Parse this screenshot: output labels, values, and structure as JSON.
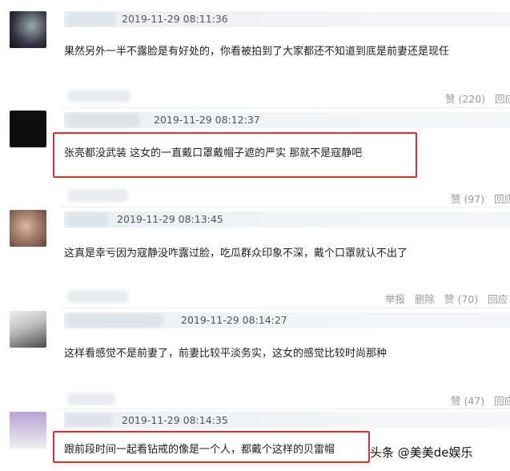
{
  "comments": [
    {
      "timestamp": "2019-11-29 08:11:36",
      "text": "果然另外一半不露脸是有好处的，你看被拍到了大家都还不知道到底是前妻还是现任",
      "actions": [
        "赞 (220)",
        "回应"
      ]
    },
    {
      "timestamp": "2019-11-29 08:12:37",
      "text": "张亮都没武装 这女的一直戴口罩戴帽子遮的严实 那就不是寇静吧",
      "actions": [
        "赞 (97)",
        "回应"
      ],
      "highlight_color": "#e03131"
    },
    {
      "timestamp": "2019-11-29 08:13:45",
      "text": "这真是幸亏因为寇静没咋露过脸，吃瓜群众印象不深，戴个口罩就认不出了",
      "actions": [
        "举报",
        "删除",
        "赞 (70)",
        "回应"
      ]
    },
    {
      "timestamp": "2019-11-29 08:14:27",
      "text": "这样看感觉不是前妻了，前妻比较平淡务实，这女的感觉比较时尚那种",
      "actions": [
        "赞 (47)",
        "回应"
      ]
    },
    {
      "timestamp": "2019-11-29 08:14:35",
      "text": "跟前段时间一起看钻戒的像是一个人，都戴个这样的贝雷帽",
      "highlight_color": "#e03131"
    }
  ],
  "footer": {
    "brand": "头条 @美美de娱乐"
  }
}
